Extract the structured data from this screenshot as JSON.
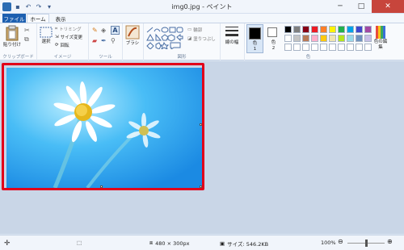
{
  "window": {
    "title": "img0.jpg - ペイント",
    "controls": {
      "minimize": "─",
      "maximize": "□",
      "close": "✕"
    }
  },
  "tabs": [
    {
      "label": "ファイル"
    },
    {
      "label": "ホーム"
    },
    {
      "label": "表示"
    }
  ],
  "ribbon": {
    "clipboard": {
      "paste_label": "貼り付け",
      "group_label": "クリップボード"
    },
    "image": {
      "select_label": "選択",
      "crop_label": "トリミング",
      "resize_label": "サイズ変更",
      "rotate_label": "回転",
      "group_label": "イメージ"
    },
    "tools": {
      "group_label": "ツール"
    },
    "brush": {
      "label": "ブラシ"
    },
    "shapes": {
      "outline_label": "輪郭",
      "fill_label": "塗りつぶし",
      "group_label": "図形"
    },
    "size": {
      "label": "線の幅"
    },
    "colors": {
      "color1_label": "色\n1",
      "color2_label": "色\n2",
      "group_label": "色",
      "edit_label": "色の編集",
      "color1": "#000000",
      "color2": "#ffffff",
      "palette_row1": [
        "#000000",
        "#7f7f7f",
        "#880015",
        "#ed1c24",
        "#ff7f27",
        "#fff200",
        "#22b14c",
        "#00a2e8",
        "#3f48cc",
        "#a349a4"
      ],
      "palette_row2": [
        "#ffffff",
        "#c3c3c3",
        "#b97a57",
        "#ffaec9",
        "#ffc90e",
        "#efe4b0",
        "#b5e61d",
        "#99d9ea",
        "#7092be",
        "#c8bfe7"
      ],
      "palette_row3": [
        "#ffffff",
        "#ffffff",
        "#ffffff",
        "#ffffff",
        "#ffffff",
        "#ffffff",
        "#ffffff",
        "#ffffff",
        "#ffffff",
        "#ffffff"
      ]
    }
  },
  "status": {
    "dimensions": "480 × 300px",
    "filesize": "サイズ: 546.2KB",
    "zoom": "100%",
    "zoom_level": 0.5
  }
}
